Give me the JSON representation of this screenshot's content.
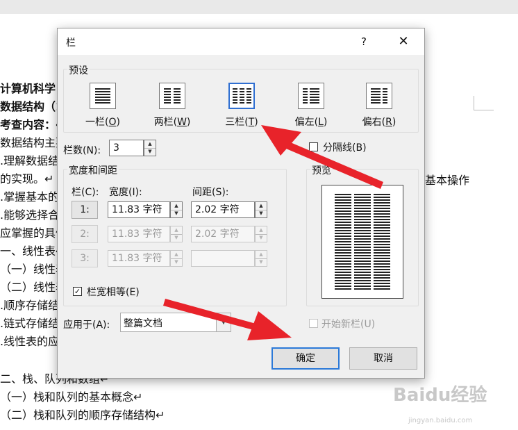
{
  "document": {
    "lines": [
      {
        "text": "计算机科学",
        "bold": true
      },
      {
        "text": "数据结构（1",
        "bold": true
      },
      {
        "text": "考查内容：↵",
        "bold": true
      },
      {
        "text": "数据结构主要"
      },
      {
        "text": ".理解数据结"
      },
      {
        "text": "的实现。↵"
      },
      {
        "text": ".掌握基本的"
      },
      {
        "text": ".能够选择合"
      },
      {
        "text": "应掌握的具体"
      },
      {
        "text": "一、线性表↵"
      },
      {
        "text": "（一）线性表"
      },
      {
        "text": "（二）线性表"
      },
      {
        "text": ".顺序存储结"
      },
      {
        "text": ".链式存储结"
      },
      {
        "text": ".线性表的应"
      },
      {
        "text": ""
      },
      {
        "text": "二、栈、队列和数组↵"
      },
      {
        "text": "（一）栈和队列的基本概念↵"
      },
      {
        "text": "（二）栈和队列的顺序存储结构↵"
      }
    ],
    "right_text": "基本操作"
  },
  "dialog": {
    "title": "栏",
    "help": "?",
    "close": "✕",
    "presets_label": "预设",
    "presets": [
      {
        "label": "一栏(",
        "key": "O",
        "suffix": ")"
      },
      {
        "label": "两栏(",
        "key": "W",
        "suffix": ")"
      },
      {
        "label": "三栏(",
        "key": "T",
        "suffix": ")"
      },
      {
        "label": "偏左(",
        "key": "L",
        "suffix": ")"
      },
      {
        "label": "偏右(",
        "key": "R",
        "suffix": ")"
      }
    ],
    "num_columns_label": "栏数(N):",
    "num_columns_value": "3",
    "separator_label": "分隔线(B)",
    "width_spacing_label": "宽度和间距",
    "col_header": "栏(C):",
    "width_header": "宽度(I):",
    "spacing_header": "间距(S):",
    "rows": [
      {
        "num": "1:",
        "width": "11.83 字符",
        "spacing": "2.02 字符"
      },
      {
        "num": "2:",
        "width": "11.83 字符",
        "spacing": "2.02 字符"
      },
      {
        "num": "3:",
        "width": "11.83 字符",
        "spacing": ""
      }
    ],
    "equal_width_label": "栏宽相等(E)",
    "equal_width_check": "✓",
    "preview_label": "预览",
    "apply_label": "应用于(A):",
    "apply_value": "整篇文档",
    "new_column_label": "开始新栏(U)",
    "ok": "确定",
    "cancel": "取消"
  },
  "watermark": {
    "text": "Baidu经验",
    "sub": "jingyan.baidu.com"
  },
  "colors": {
    "accent": "#2b79d8",
    "arrow": "#e8232a"
  }
}
